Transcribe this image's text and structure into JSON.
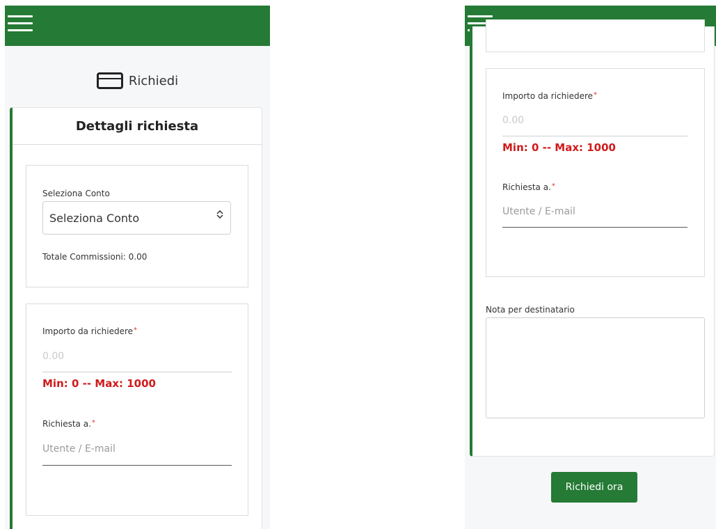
{
  "brand": {
    "primary_color": "#257a35",
    "error_color": "#d01b1b"
  },
  "icons": {
    "menu": "hamburger-menu-icon",
    "card": "credit-card-icon",
    "select": "chevron-up-down-icon"
  },
  "page": {
    "title": "Richiedi"
  },
  "panel": {
    "title": "Dettagli richiesta"
  },
  "account": {
    "label": "Seleziona Conto",
    "selected": "Seleziona Conto",
    "commissions_label": "Totale Commissioni: 0.00"
  },
  "amount": {
    "label": "Importo da richiedere",
    "required_mark": "*",
    "placeholder": "0.00",
    "limits": "Min: 0 -- Max: 1000"
  },
  "recipient": {
    "label": "Richiesta a.",
    "required_mark": "*",
    "placeholder": "Utente / E-mail"
  },
  "note": {
    "label": "Nota per destinatario",
    "value": ""
  },
  "submit": {
    "label": "Richiedi ora"
  }
}
